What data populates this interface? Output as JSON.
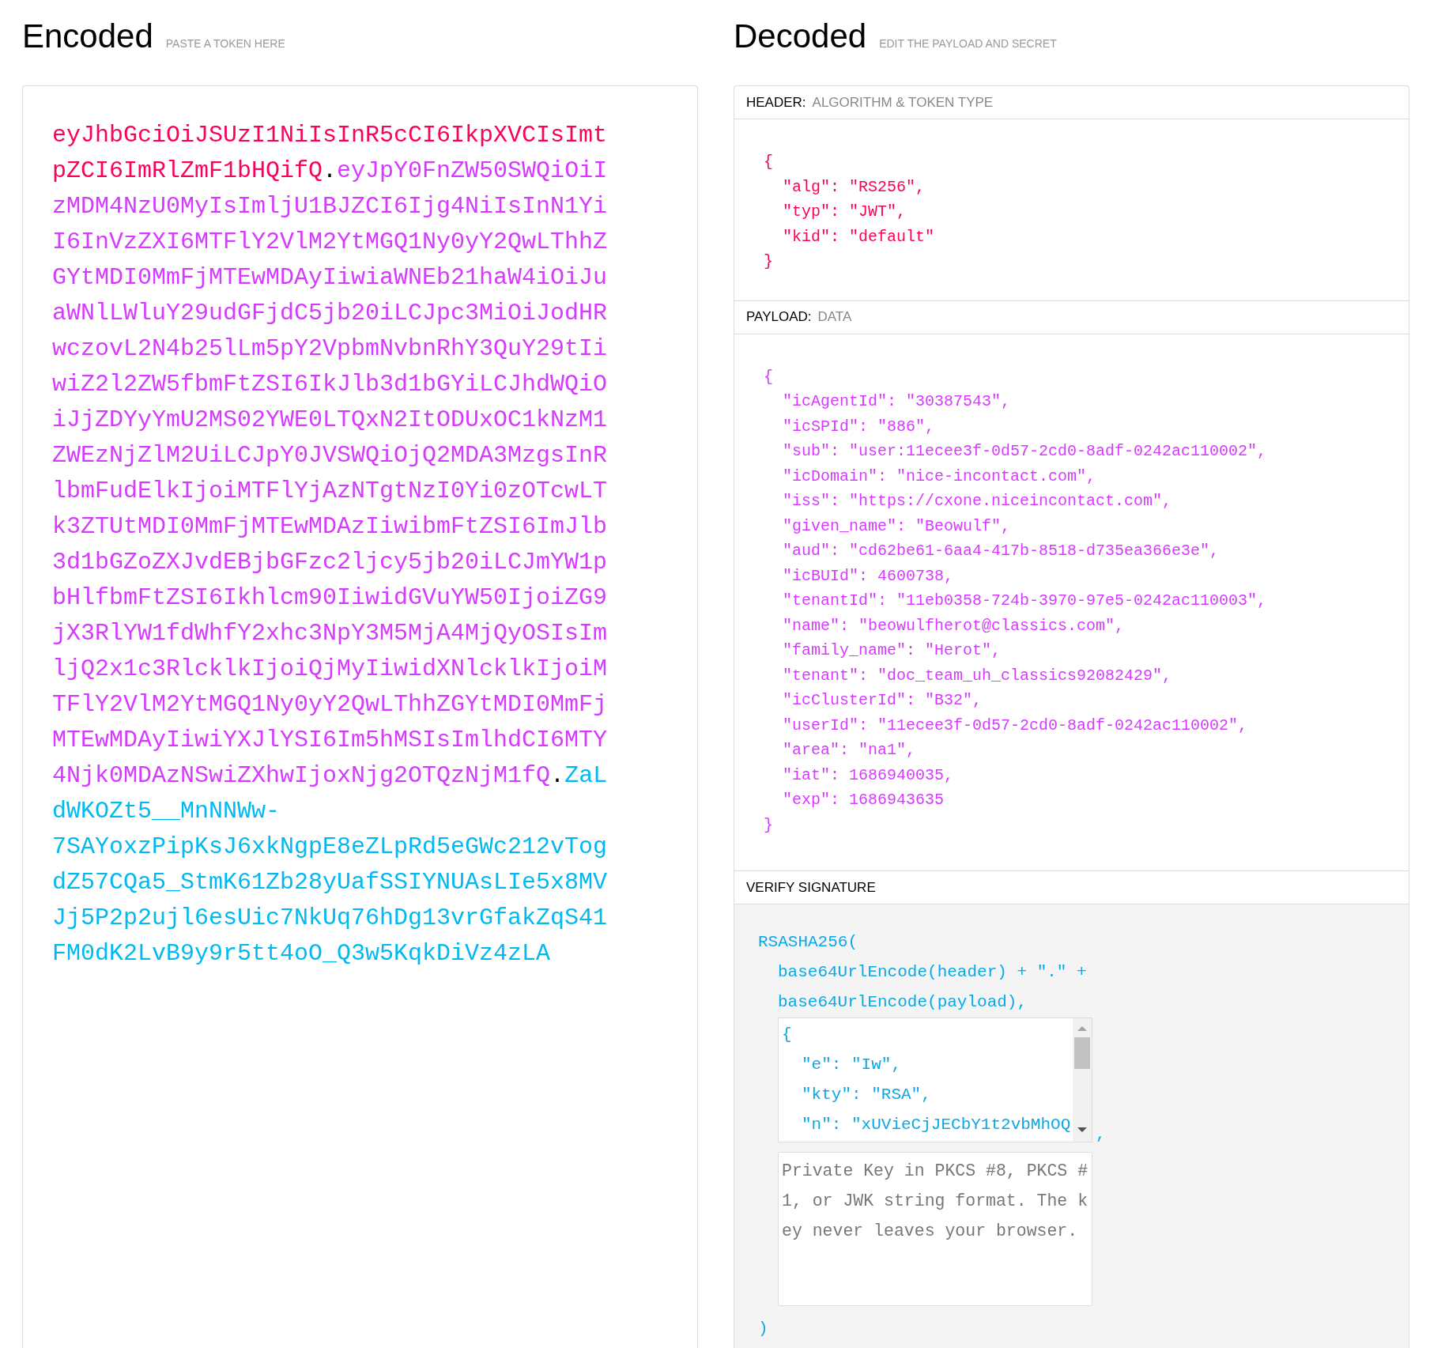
{
  "encoded": {
    "title": "Encoded",
    "hint": "PASTE A TOKEN HERE",
    "token": [
      {
        "kind": "header",
        "text": "eyJhbGciOiJSUzI1NiIsInR5cCI6IkpXVCIsImtpZCI6ImRlZmF1bHQifQ"
      },
      {
        "kind": "separator",
        "text": "."
      },
      {
        "kind": "payload",
        "text": "eyJpY0FnZW50SWQiOiIzMDM4NzU0MyIsImljU1BJZCI6Ijg4NiIsInN1YiI6InVzZXI6MTFlY2VlM2YtMGQ1Ny0yY2QwLThhZGYtMDI0MmFjMTEwMDAyIiwiaWNEb21haW4iOiJuaWNlLWluY29udGFjdC5jb20iLCJpc3MiOiJodHRwczovL2N4b25lLm5pY2VpbmNvbnRhY3QuY29tIiwiZ2l2ZW5fbmFtZSI6IkJlb3d1bGYiLCJhdWQiOiJjZDYyYmU2MS02YWE0LTQxN2ItODUxOC1kNzM1ZWEzNjZlM2UiLCJpY0JVSWQiOjQ2MDA3MzgsInRlbmFudElkIjoiMTFlYjAzNTgtNzI0Yi0zOTcwLTk3ZTUtMDI0MmFjMTEwMDAzIiwibmFtZSI6ImJlb3d1bGZoZXJvdEBjbGFzc2ljcy5jb20iLCJmYW1pbHlfbmFtZSI6Ikhlcm90IiwidGVuYW50IjoiZG9jX3RlYW1fdWhfY2xhc3NpY3M5MjA4MjQyOSIsImljQ2x1c3RlcklkIjoiQjMyIiwidXNlcklkIjoiMTFlY2VlM2YtMGQ1Ny0yY2QwLThhZGYtMDI0MmFjMTEwMDAyIiwiYXJlYSI6Im5hMSIsImlhdCI6MTY4Njk0MDAzNSwiZXhwIjoxNjg2OTQzNjM1fQ"
      },
      {
        "kind": "separator",
        "text": "."
      },
      {
        "kind": "signature",
        "text": "ZaLdWKOZt5__MnNNWw-7SAYoxzPipKsJ6xkNgpE8eZLpRd5eGWc212vTogdZ57CQa5_StmK61Zb28yUafSSIYNUAsLIe5x8MVJj5P2p2ujl6esUic7NkUq76hDg13vrGfakZqS41FM0dK2LvB9y9r5tt4oO_Q3w5KqkDiVz4zLA"
      }
    ]
  },
  "decoded": {
    "title": "Decoded",
    "hint": "EDIT THE PAYLOAD AND SECRET",
    "header": {
      "label": "HEADER:",
      "sublabel": "ALGORITHM & TOKEN TYPE",
      "lines": [
        {
          "kind": "brace",
          "text": "{"
        },
        {
          "kind": "entry",
          "text": "\"alg\": \"RS256\","
        },
        {
          "kind": "entry",
          "text": "\"typ\": \"JWT\","
        },
        {
          "kind": "entry",
          "text": "\"kid\": \"default\""
        },
        {
          "kind": "brace",
          "text": "}"
        }
      ]
    },
    "payload": {
      "label": "PAYLOAD:",
      "sublabel": "DATA",
      "lines": [
        {
          "kind": "brace",
          "text": "{"
        },
        {
          "kind": "entry",
          "text": "\"icAgentId\": \"30387543\","
        },
        {
          "kind": "entry",
          "text": "\"icSPId\": \"886\","
        },
        {
          "kind": "entry",
          "text": "\"sub\": \"user:11ecee3f-0d57-2cd0-8adf-0242ac110002\","
        },
        {
          "kind": "entry",
          "text": "\"icDomain\": \"nice-incontact.com\","
        },
        {
          "kind": "entry",
          "text": "\"iss\": \"https://cxone.niceincontact.com\","
        },
        {
          "kind": "entry",
          "text": "\"given_name\": \"Beowulf\","
        },
        {
          "kind": "entry",
          "text": "\"aud\": \"cd62be61-6aa4-417b-8518-d735ea366e3e\","
        },
        {
          "kind": "entry",
          "text": "\"icBUId\": 4600738,"
        },
        {
          "kind": "entry",
          "text": "\"tenantId\": \"11eb0358-724b-3970-97e5-0242ac110003\","
        },
        {
          "kind": "entry",
          "text": "\"name\": \"beowulfherot@classics.com\","
        },
        {
          "kind": "entry",
          "text": "\"family_name\": \"Herot\","
        },
        {
          "kind": "entry",
          "text": "\"tenant\": \"doc_team_uh_classics92082429\","
        },
        {
          "kind": "entry",
          "text": "\"icClusterId\": \"B32\","
        },
        {
          "kind": "entry",
          "text": "\"userId\": \"11ecee3f-0d57-2cd0-8adf-0242ac110002\","
        },
        {
          "kind": "entry",
          "text": "\"area\": \"na1\","
        },
        {
          "kind": "entry",
          "text": "\"iat\": 1686940035,"
        },
        {
          "kind": "entry",
          "text": "\"exp\": 1686943635"
        },
        {
          "kind": "brace",
          "text": "}"
        }
      ]
    },
    "verify": {
      "label": "VERIFY SIGNATURE",
      "lines": [
        {
          "kind": "call",
          "text": "RSASHA256("
        },
        {
          "kind": "arg",
          "text": "base64UrlEncode(header) + \".\" +"
        },
        {
          "kind": "arg",
          "text": "base64UrlEncode(payload),"
        }
      ],
      "public_key": {
        "lines": [
          {
            "kind": "brace",
            "text": "{"
          },
          {
            "kind": "entry",
            "text": "\"e\": \"Iw\","
          },
          {
            "kind": "entry",
            "text": "\"kty\": \"RSA\","
          },
          {
            "kind": "entry",
            "text": "\"n\": \"xUVieCjJECbY1t2vbMhOQ"
          }
        ]
      },
      "separator": ",",
      "private_key": {
        "placeholder": "Private Key in PKCS #8, PKCS #1, or JWK string format. The key never leaves your browser."
      },
      "closing": ")"
    }
  }
}
